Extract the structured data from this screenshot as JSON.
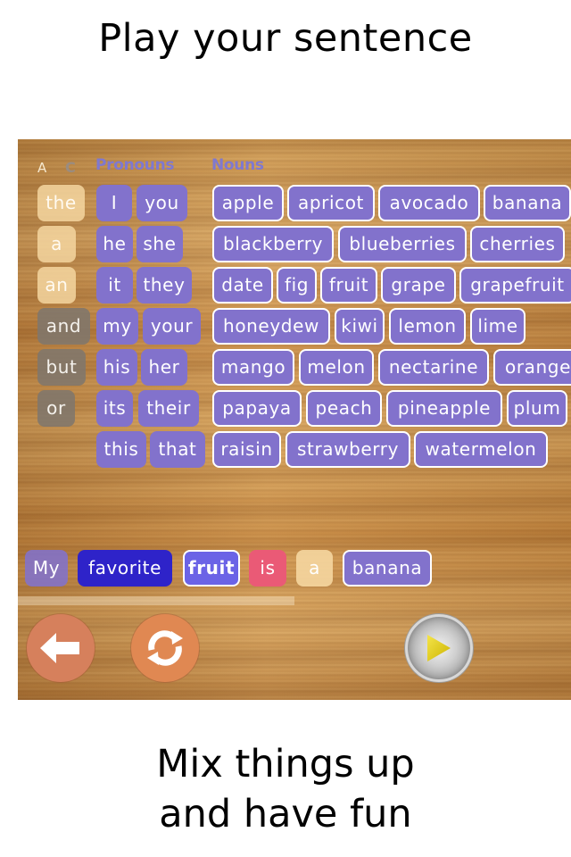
{
  "captions": {
    "top": "Play your sentence",
    "bottom_line1": "Mix things up",
    "bottom_line2": "and have fun"
  },
  "headers": {
    "articles": "A",
    "conjunctions": "C",
    "pronouns": "Pronouns",
    "nouns": "Nouns"
  },
  "articles": [
    "the",
    "a",
    "an"
  ],
  "conjunctions": [
    "and",
    "but",
    "or"
  ],
  "pronouns": [
    [
      "I",
      "you"
    ],
    [
      "he",
      "she"
    ],
    [
      "it",
      "they"
    ],
    [
      "my",
      "your"
    ],
    [
      "his",
      "her"
    ],
    [
      "its",
      "their"
    ],
    [
      "this",
      "that"
    ]
  ],
  "nouns": [
    [
      "apple",
      "apricot",
      "avocado",
      "banana"
    ],
    [
      "blackberry",
      "blueberries",
      "cherries"
    ],
    [
      "date",
      "fig",
      "fruit",
      "grape",
      "grapefruit"
    ],
    [
      "honeydew",
      "kiwi",
      "lemon",
      "lime"
    ],
    [
      "mango",
      "melon",
      "nectarine",
      "orange"
    ],
    [
      "papaya",
      "peach",
      "pineapple",
      "plum"
    ],
    [
      "raisin",
      "strawberry",
      "watermelon"
    ]
  ],
  "sentence": [
    "My",
    "favorite",
    "fruit",
    "is",
    "a",
    "banana"
  ],
  "buttons": {
    "back": "arrow-left-icon",
    "shuffle": "refresh-icon",
    "play": "play-icon"
  },
  "colors": {
    "article": "#F5D6A0",
    "conjunction": "#80766C",
    "pronoun": "#8272CC",
    "noun": "#8272CC",
    "adjective": "#2E23C9",
    "verb": "#EA5A76",
    "back_button": "#D6805C",
    "shuffle_button": "#E08852",
    "play_triangle": "#E8D21A"
  }
}
